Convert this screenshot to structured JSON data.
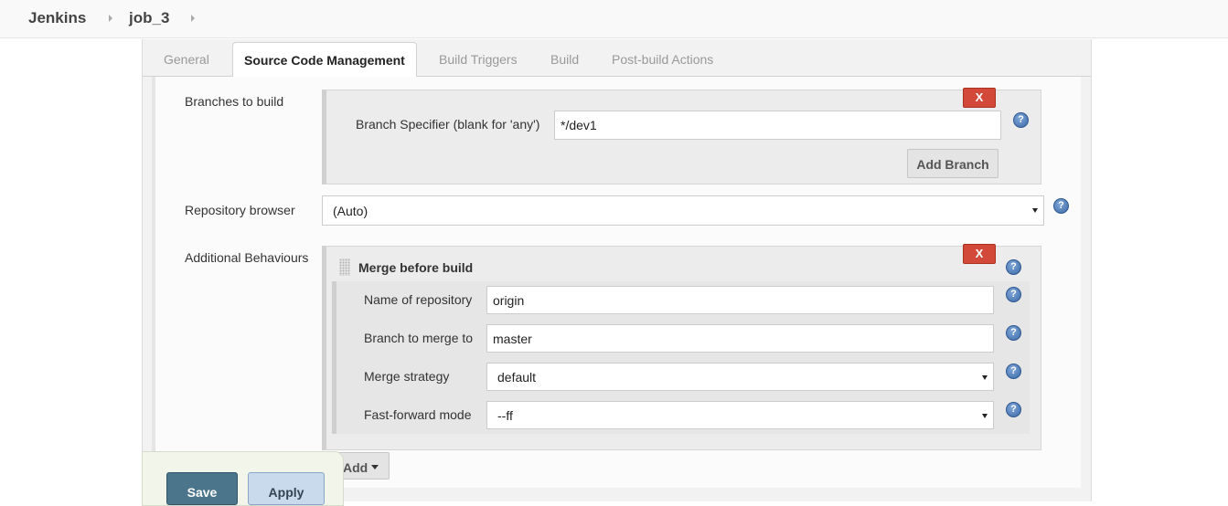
{
  "breadcrumb": {
    "items": [
      {
        "label": "Jenkins"
      },
      {
        "label": "job_3"
      }
    ]
  },
  "tabs": [
    {
      "label": "General",
      "active": false
    },
    {
      "label": "Source Code Management",
      "active": true
    },
    {
      "label": "Build Triggers",
      "active": false
    },
    {
      "label": "Build",
      "active": false
    },
    {
      "label": "Post-build Actions",
      "active": false
    }
  ],
  "branches": {
    "section_label": "Branches to build",
    "remove_label": "X",
    "specifier_label": "Branch Specifier (blank for 'any')",
    "specifier_value": "*/dev1",
    "add_branch_label": "Add Branch"
  },
  "repo_browser": {
    "label": "Repository browser",
    "selected": "(Auto)"
  },
  "behaviours": {
    "section_label": "Additional Behaviours",
    "remove_label": "X",
    "merge": {
      "title": "Merge before build",
      "repo_label": "Name of repository",
      "repo_value": "origin",
      "branch_label": "Branch to merge to",
      "branch_value": "master",
      "strategy_label": "Merge strategy",
      "strategy_value": "default",
      "ff_label": "Fast-forward mode",
      "ff_value": "--ff"
    },
    "add_label": "Add"
  },
  "actions": {
    "save_label": "Save",
    "apply_label": "Apply"
  },
  "icons": {
    "help": "help-icon",
    "remove": "close-icon",
    "dropdown": "chevron-down-icon",
    "drag": "drag-handle-icon"
  },
  "colors": {
    "danger": "#d24939",
    "save": "#4b758b",
    "apply": "#c9daec",
    "help": "#3e6aa8"
  }
}
